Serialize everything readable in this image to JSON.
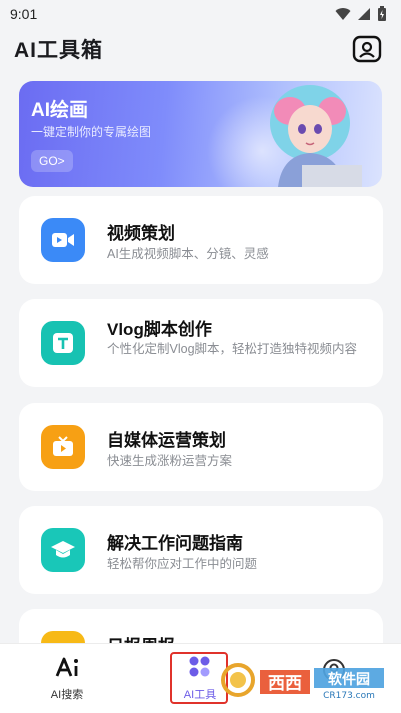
{
  "status_bar": {
    "time": "9:01"
  },
  "header": {
    "title": "AI工具箱"
  },
  "banner": {
    "title": "AI绘画",
    "subtitle": "一键定制你的专属绘图",
    "button": "GO>"
  },
  "cards": [
    {
      "title": "视频策划",
      "desc": "AI生成视频脚本、分镜、灵感",
      "icon": "video-icon",
      "color": "#3b8af7"
    },
    {
      "title": "Vlog脚本创作",
      "desc": "个性化定制Vlog脚本，轻松打造独特视频内容",
      "icon": "text-t-icon",
      "color": "#17c2b2"
    },
    {
      "title": "自媒体运营策划",
      "desc": "快速生成涨粉运营方案",
      "icon": "play-icon",
      "color": "#f7a014"
    },
    {
      "title": "解决工作问题指南",
      "desc": "轻松帮你应对工作中的问题",
      "icon": "graduation-cap-icon",
      "color": "#19c7b8"
    },
    {
      "title": "日报周报",
      "desc": "",
      "icon": "report-icon",
      "color": "#f7b916"
    }
  ],
  "bottom_nav": {
    "items": [
      {
        "label": "AI搜索",
        "icon": "ai-search-icon"
      },
      {
        "label": "AI工具",
        "icon": "grid-icon"
      },
      {
        "label": "",
        "icon": "profile-icon"
      }
    ]
  },
  "watermark": {
    "brand": "西西",
    "text": "软件园",
    "url": "CR173.com"
  }
}
